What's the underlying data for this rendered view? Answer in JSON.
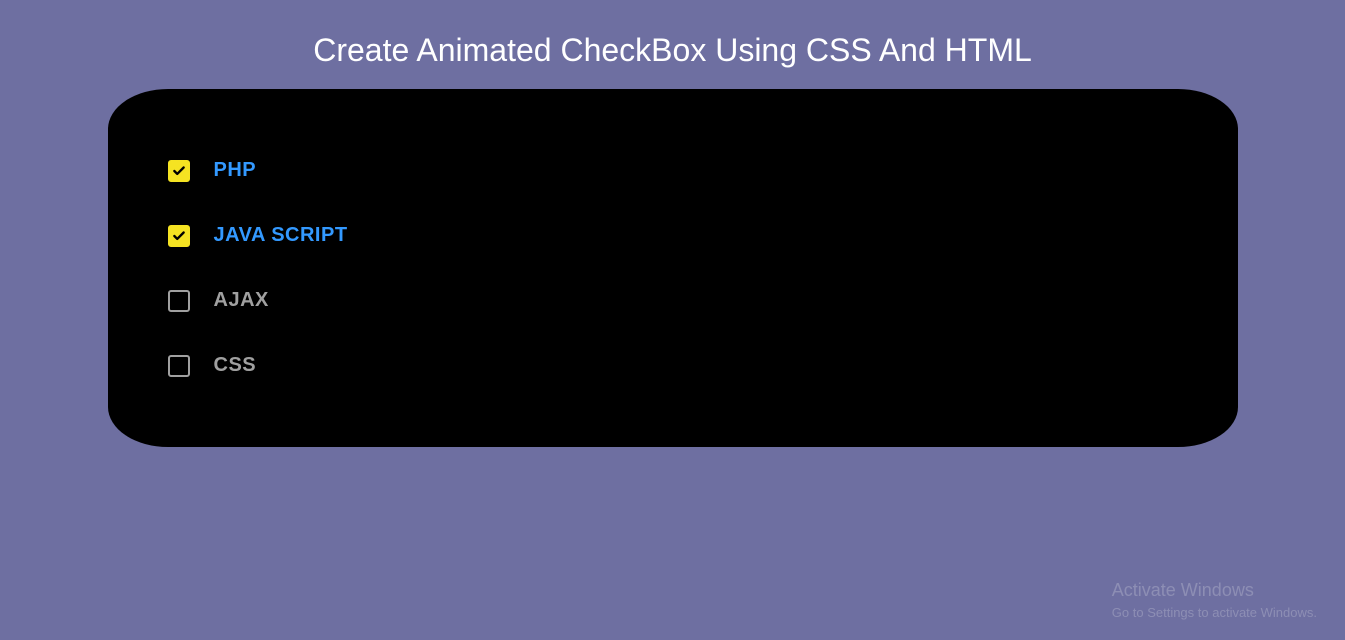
{
  "title": "Create Animated CheckBox Using CSS And HTML",
  "items": [
    {
      "label": "PHP",
      "checked": true
    },
    {
      "label": "JAVA SCRIPT",
      "checked": true
    },
    {
      "label": "AJAX",
      "checked": false
    },
    {
      "label": "CSS",
      "checked": false
    }
  ],
  "watermark": {
    "title": "Activate Windows",
    "sub": "Go to Settings to activate Windows."
  }
}
